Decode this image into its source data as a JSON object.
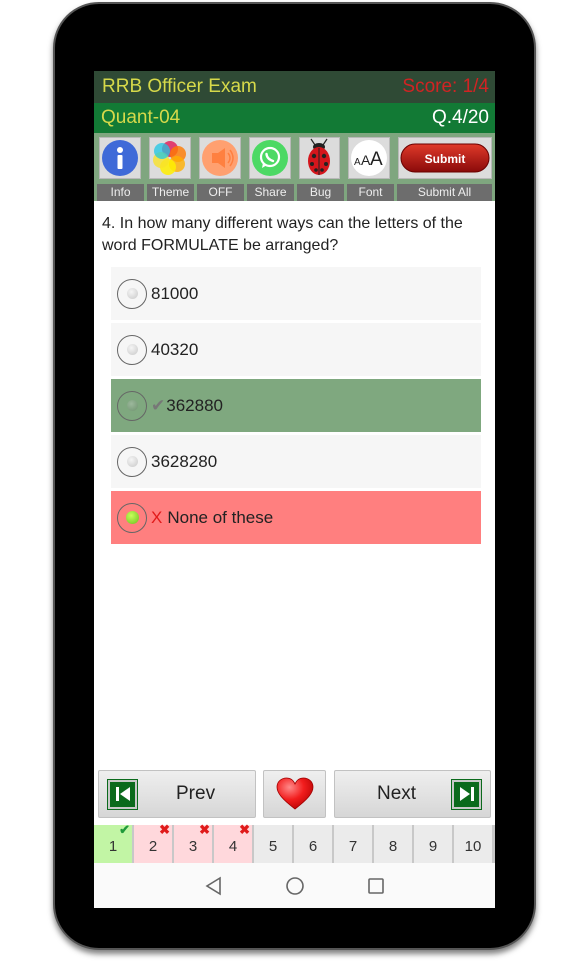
{
  "header": {
    "app_title": "RRB Officer Exam",
    "score": "Score: 1/4",
    "quiz_name": "Quant-04",
    "question_counter": "Q.4/20"
  },
  "toolbar": {
    "items": [
      {
        "icon": "info-icon",
        "label": "Info"
      },
      {
        "icon": "theme-icon",
        "label": "Theme"
      },
      {
        "icon": "speaker-icon",
        "label": "OFF"
      },
      {
        "icon": "whatsapp-share-icon",
        "label": "Share"
      },
      {
        "icon": "ladybug-icon",
        "label": "Bug"
      },
      {
        "icon": "font-size-icon",
        "label": "Font",
        "glyph": "AAA"
      },
      {
        "icon": "submit-icon",
        "label": "Submit All",
        "button_text": "Submit"
      }
    ]
  },
  "question": {
    "text": "4. In how many different ways can the letters of the word FORMULATE be arranged?",
    "options": [
      {
        "text": "81000",
        "state": "none",
        "mark": ""
      },
      {
        "text": "40320",
        "state": "none",
        "mark": ""
      },
      {
        "text": "362880",
        "state": "correct",
        "mark": "✔"
      },
      {
        "text": "3628280",
        "state": "none",
        "mark": ""
      },
      {
        "text": "None of these",
        "state": "wrong-selected",
        "mark": "X"
      }
    ]
  },
  "navigation": {
    "prev_label": "Prev",
    "next_label": "Next",
    "favorite_icon": "heart-icon"
  },
  "question_grid": [
    {
      "number": "1",
      "status": "correct",
      "badge": "✔"
    },
    {
      "number": "2",
      "status": "wrong",
      "badge": "✖"
    },
    {
      "number": "3",
      "status": "wrong",
      "badge": "✖"
    },
    {
      "number": "4",
      "status": "wrong",
      "badge": "✖"
    },
    {
      "number": "5",
      "status": "unanswered",
      "badge": ""
    },
    {
      "number": "6",
      "status": "unanswered",
      "badge": ""
    },
    {
      "number": "7",
      "status": "unanswered",
      "badge": ""
    },
    {
      "number": "8",
      "status": "unanswered",
      "badge": ""
    },
    {
      "number": "9",
      "status": "unanswered",
      "badge": ""
    },
    {
      "number": "10",
      "status": "unanswered",
      "badge": ""
    }
  ],
  "colors": {
    "title_bg": "#2f4a35",
    "subtitle_bg": "#127a35",
    "title_text": "#d6d94a",
    "score_text": "#d12323",
    "correct_bg": "#7fa87f",
    "wrong_bg": "#ff7f7f"
  }
}
